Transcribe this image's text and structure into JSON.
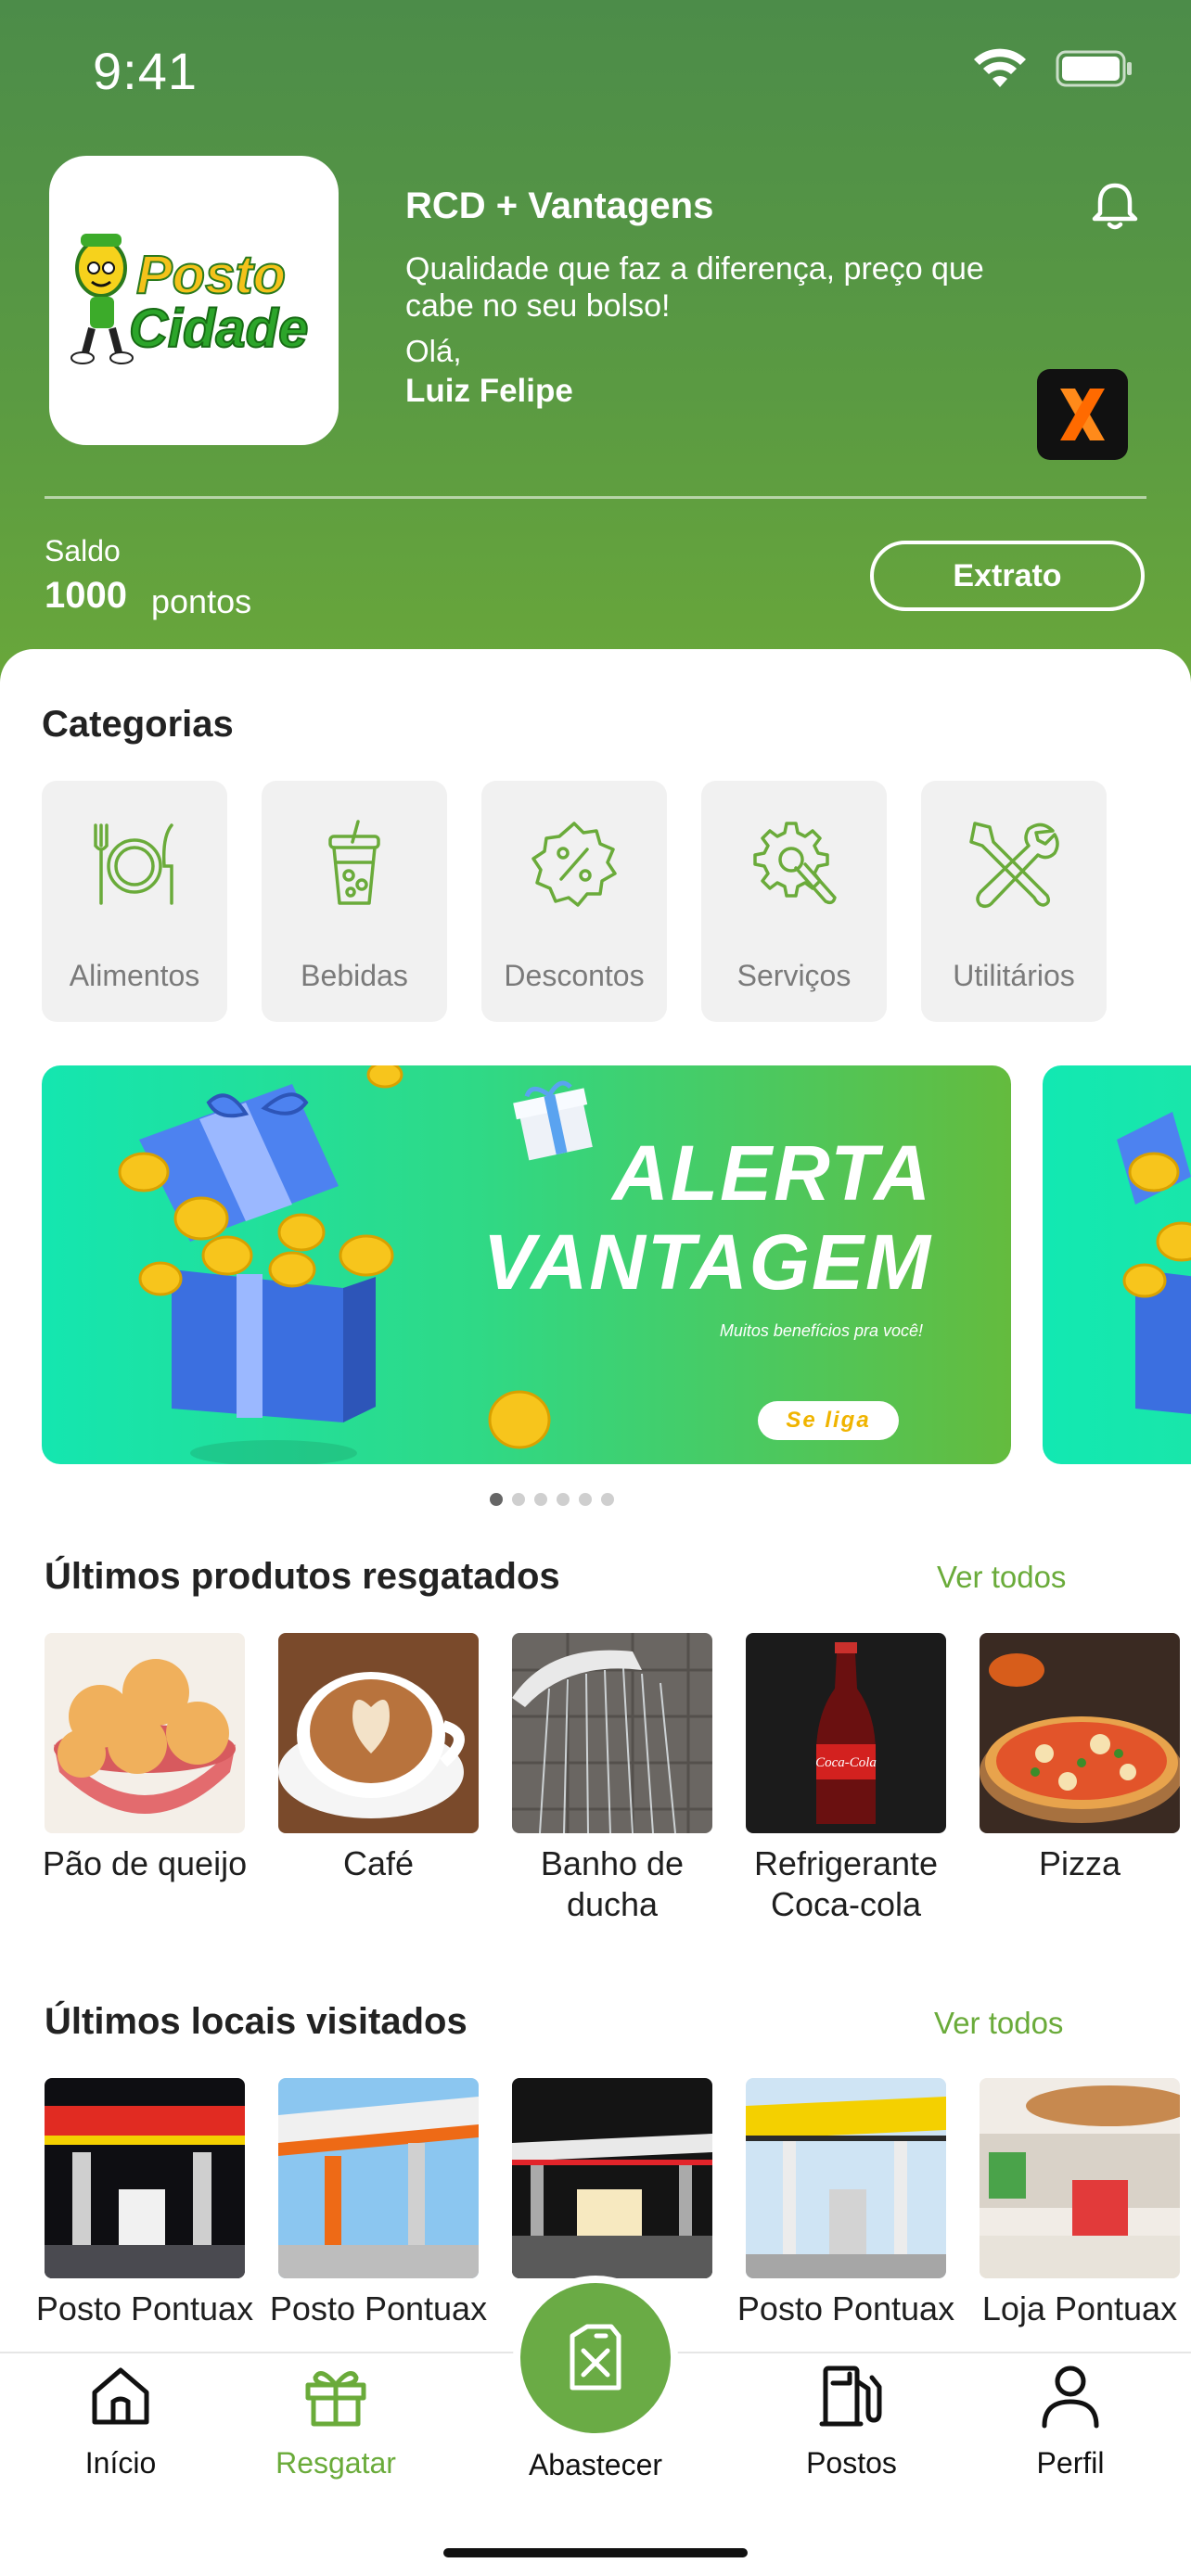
{
  "status_bar": {
    "time": "9:41",
    "icons": [
      "wifi-icon",
      "battery-icon"
    ]
  },
  "header": {
    "logo_text_line1": "Posto",
    "logo_text_line2": "Cidade",
    "title": "RCD + Vantagens",
    "slogan": "Qualidade que faz a diferença, preço que cabe no seu bolso!",
    "greeting": "Olá,",
    "user_name": "Luiz Felipe",
    "bell_icon": "bell-icon",
    "badge_icon": "x-brand-icon"
  },
  "balance": {
    "label": "Saldo",
    "value": "1000",
    "unit": "pontos",
    "button_label": "Extrato"
  },
  "categories": {
    "title": "Categorias",
    "items": [
      {
        "label": "Alimentos",
        "icon": "plate-cutlery-icon"
      },
      {
        "label": "Bebidas",
        "icon": "drink-cup-icon"
      },
      {
        "label": "Descontos",
        "icon": "percent-badge-icon"
      },
      {
        "label": "Serviços",
        "icon": "gear-wrench-icon"
      },
      {
        "label": "Utilitários",
        "icon": "tools-icon"
      }
    ]
  },
  "banner": {
    "title_line1": "ALERTA",
    "title_line2": "VANTAGEM",
    "subtitle": "Muitos benefícios pra você!",
    "cta": "Se liga",
    "slide_count": 6,
    "active_slide": 0
  },
  "redeemed": {
    "title": "Últimos produtos resgatados",
    "see_all": "Ver todos",
    "items": [
      {
        "label": "Pão de queijo"
      },
      {
        "label": "Café"
      },
      {
        "label": "Banho de ducha"
      },
      {
        "label": "Refrigerante Coca-cola"
      },
      {
        "label": "Pizza"
      }
    ]
  },
  "visited": {
    "title": "Últimos locais visitados",
    "see_all": "Ver todos",
    "items": [
      {
        "label": "Posto Pontuax"
      },
      {
        "label": "Posto Pontuax"
      },
      {
        "label": "Posto Pontuax"
      },
      {
        "label": "Posto Pontuax"
      },
      {
        "label": "Loja Pontuax"
      }
    ]
  },
  "nav": {
    "items": [
      {
        "label": "Início",
        "icon": "home-icon"
      },
      {
        "label": "Resgatar",
        "icon": "gift-icon",
        "active": true
      },
      {
        "label": "Abastecer",
        "icon": "fuel-can-icon"
      },
      {
        "label": "Postos",
        "icon": "gas-pump-icon"
      },
      {
        "label": "Perfil",
        "icon": "user-icon"
      }
    ]
  },
  "colors": {
    "brand_green": "#6aab3a",
    "header_green": "#4c8c49",
    "fab_green": "#6aab45"
  }
}
